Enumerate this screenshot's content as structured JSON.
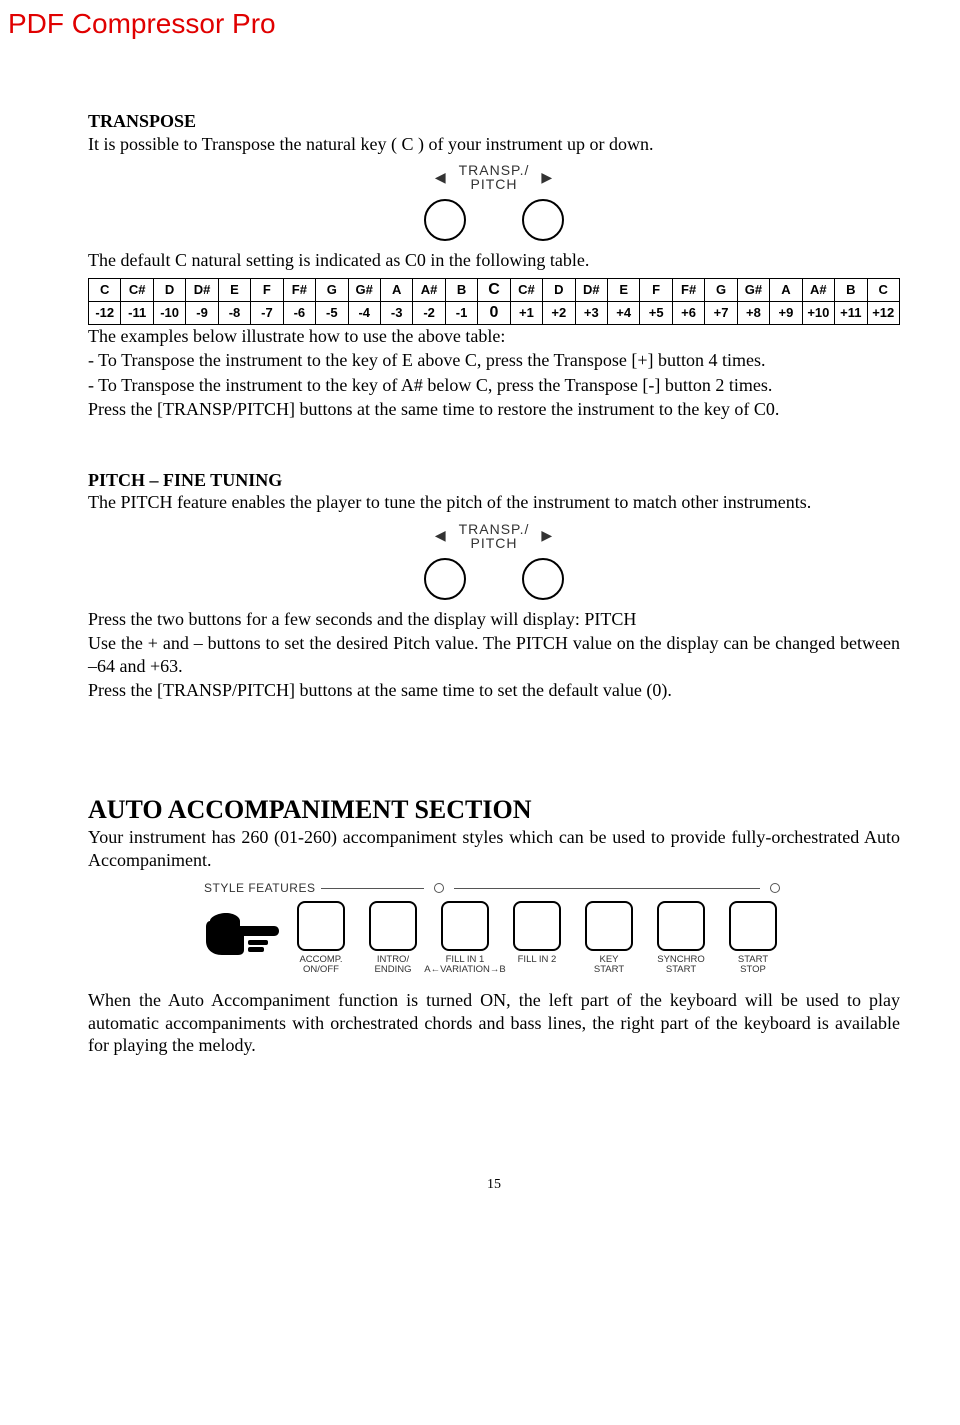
{
  "watermark": "PDF Compressor Pro",
  "transpose": {
    "heading": "TRANSPOSE",
    "intro": "It is possible to Transpose the natural key ( C ) of your instrument up or down.",
    "diagram": {
      "l1": "TRANSP./",
      "l2": "PITCH"
    },
    "default_line": "The default C natural setting is indicated as C0 in the following table.",
    "table": {
      "notes": [
        "C",
        "C#",
        "D",
        "D#",
        "E",
        "F",
        "F#",
        "G",
        "G#",
        "A",
        "A#",
        "B",
        "C",
        "C#",
        "D",
        "D#",
        "E",
        "F",
        "F#",
        "G",
        "G#",
        "A",
        "A#",
        "B",
        "C"
      ],
      "offsets": [
        "-12",
        "-11",
        "-10",
        "-9",
        "-8",
        "-7",
        "-6",
        "-5",
        "-4",
        "-3",
        "-2",
        "-1",
        "0",
        "+1",
        "+2",
        "+3",
        "+4",
        "+5",
        "+6",
        "+7",
        "+8",
        "+9",
        "+10",
        "+11",
        "+12"
      ]
    },
    "examples_lead": "The examples below illustrate how to use the above table:",
    "example1": "- To Transpose the instrument to the key of E above C, press the Transpose [+] button 4 times.",
    "example2": "- To Transpose the instrument to the key of A# below C, press the Transpose [-] button 2 times.",
    "restore": "Press  the [TRANSP/PITCH] buttons at the same time to restore the instrument to the key of C0."
  },
  "pitch": {
    "heading": "PITCH – FINE TUNING",
    "intro": "The PITCH feature enables the player to tune the pitch of the instrument to match other instruments.",
    "diagram": {
      "l1": "TRANSP./",
      "l2": "PITCH"
    },
    "line1": "Press the two buttons for a few seconds and the display will display: PITCH",
    "line2": "Use the + and – buttons to set the desired Pitch value. The PITCH value on the display can be changed between –64 and +63.",
    "line3": "Press  the [TRANSP/PITCH] buttons at the same time to set the default value (0)."
  },
  "accomp": {
    "heading": "AUTO ACCOMPANIMENT SECTION",
    "intro": "Your instrument has 260 (01-260) accompaniment styles which can be used to provide fully-orchestrated Auto Accompaniment.",
    "features_title": "STYLE FEATURES",
    "buttons": [
      {
        "l1": "ACCOMP.",
        "l2": "ON/OFF"
      },
      {
        "l1": "INTRO/",
        "l2": "ENDING"
      },
      {
        "l1": "FILL IN 1",
        "l2": "A←VARIATION→B"
      },
      {
        "l1": "FILL IN 2",
        "l2": ""
      },
      {
        "l1": "KEY",
        "l2": "START"
      },
      {
        "l1": "SYNCHRO",
        "l2": "START"
      },
      {
        "l1": "START",
        "l2": "STOP"
      }
    ],
    "body": "When the Auto Accompaniment function is turned ON, the left part of the keyboard will be used to play automatic accompaniments with orchestrated chords and bass lines, the right part of the keyboard is available for playing the melody."
  },
  "page_number": "15"
}
